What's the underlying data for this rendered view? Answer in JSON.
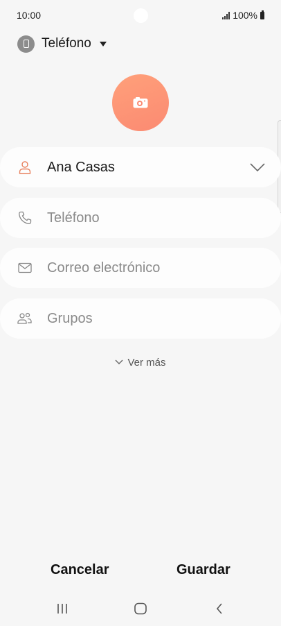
{
  "status_bar": {
    "time": "10:00",
    "battery": "100%"
  },
  "account": {
    "label": "Teléfono",
    "icon": "phone-account-icon"
  },
  "photo": {
    "icon": "camera-icon",
    "accent_color": "#fb8a72"
  },
  "fields": [
    {
      "icon": "person-icon",
      "value": "Ana Casas",
      "placeholder": "",
      "expandable": true
    },
    {
      "icon": "phone-icon",
      "value": "",
      "placeholder": "Teléfono"
    },
    {
      "icon": "email-icon",
      "value": "",
      "placeholder": "Correo electrónico"
    },
    {
      "icon": "groups-icon",
      "value": "",
      "placeholder": "Grupos"
    }
  ],
  "more": {
    "label": "Ver más"
  },
  "actions": {
    "cancel": "Cancelar",
    "save": "Guardar"
  },
  "nav": {
    "recents": "recents-icon",
    "home": "home-icon",
    "back": "back-icon"
  }
}
